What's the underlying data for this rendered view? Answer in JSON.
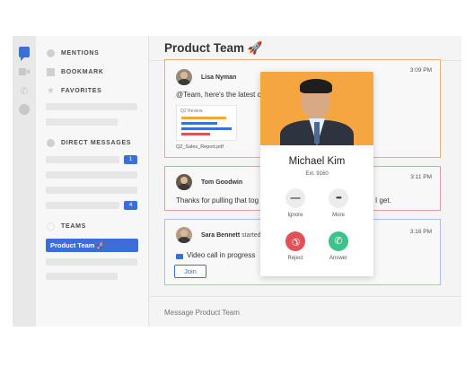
{
  "sidebar": {
    "sections": {
      "mentions": "MENTIONS",
      "bookmark": "BOOKMARK",
      "favorites": "FAVORITES",
      "direct_messages": "DIRECT MESSAGES",
      "teams": "TEAMS"
    },
    "badges": [
      "1",
      "4"
    ],
    "active_team": "Product Team 🚀"
  },
  "header": {
    "title": "Product Team 🚀"
  },
  "messages": [
    {
      "author": "Lisa Nyman",
      "time": "3:09 PM",
      "text": "@Team, here's the latest c",
      "attachment": {
        "label": "Q2 Review",
        "file_name": "Q2_Sales_Report.pdf"
      }
    },
    {
      "author": "Tom Goodwin",
      "time": "3:11 PM",
      "text_left": "Thanks for pulling that tog",
      "text_right": "I get."
    },
    {
      "author": "Sara Bennett",
      "author_suffix": "started a",
      "time": "3:16 PM",
      "text": "Video call in progress",
      "join_label": "Join"
    }
  ],
  "composer": {
    "placeholder": "Message Product Team"
  },
  "call": {
    "name": "Michael Kim",
    "ext": "Ext. 9160",
    "actions": {
      "ignore": {
        "label": "Ignore",
        "glyph": "—"
      },
      "more": {
        "label": "More",
        "glyph": "•••"
      },
      "reject": {
        "label": "Reject",
        "glyph": "✆"
      },
      "answer": {
        "label": "Answer",
        "glyph": "✆"
      }
    }
  },
  "colors": {
    "accent": "#3b6fd8",
    "photo_bg": "#f5a640",
    "reject": "#e05258",
    "answer": "#3cc28a"
  },
  "icons": [
    "chat-icon",
    "video-icon",
    "phone-icon",
    "user-icon",
    "at-icon",
    "bookmark-icon",
    "star-icon",
    "person-icon",
    "teams-icon",
    "video-call-icon"
  ]
}
